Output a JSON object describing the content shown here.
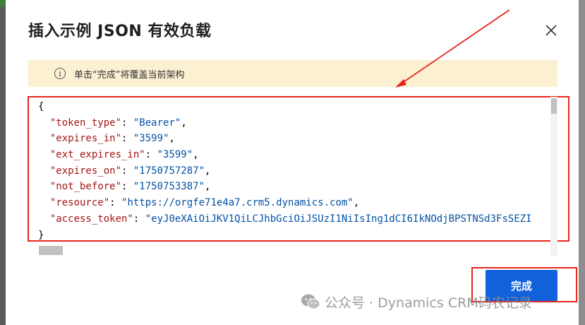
{
  "dialog": {
    "title": "插入示例 JSON 有效负载",
    "info_text": "单击“完成”将覆盖当前架构",
    "done_label": "完成"
  },
  "editor": {
    "lines": [
      [
        {
          "t": "p",
          "v": "{"
        }
      ],
      [
        {
          "t": "p",
          "v": "  "
        },
        {
          "t": "k",
          "v": "\"token_type\""
        },
        {
          "t": "p",
          "v": ": "
        },
        {
          "t": "s",
          "v": "\"Bearer\""
        },
        {
          "t": "p",
          "v": ","
        }
      ],
      [
        {
          "t": "p",
          "v": "  "
        },
        {
          "t": "k",
          "v": "\"expires_in\""
        },
        {
          "t": "p",
          "v": ": "
        },
        {
          "t": "s",
          "v": "\"3599\""
        },
        {
          "t": "p",
          "v": ","
        }
      ],
      [
        {
          "t": "p",
          "v": "  "
        },
        {
          "t": "k",
          "v": "\"ext_expires_in\""
        },
        {
          "t": "p",
          "v": ": "
        },
        {
          "t": "s",
          "v": "\"3599\""
        },
        {
          "t": "p",
          "v": ","
        }
      ],
      [
        {
          "t": "p",
          "v": "  "
        },
        {
          "t": "k",
          "v": "\"expires_on\""
        },
        {
          "t": "p",
          "v": ": "
        },
        {
          "t": "s",
          "v": "\"1750757287\""
        },
        {
          "t": "p",
          "v": ","
        }
      ],
      [
        {
          "t": "p",
          "v": "  "
        },
        {
          "t": "k",
          "v": "\"not_before\""
        },
        {
          "t": "p",
          "v": ": "
        },
        {
          "t": "s",
          "v": "\"1750753387\""
        },
        {
          "t": "p",
          "v": ","
        }
      ],
      [
        {
          "t": "p",
          "v": "  "
        },
        {
          "t": "k",
          "v": "\"resource\""
        },
        {
          "t": "p",
          "v": ": "
        },
        {
          "t": "s",
          "v": "\"https://orgfe71e4a7.crm5.dynamics.com\""
        },
        {
          "t": "p",
          "v": ","
        }
      ],
      [
        {
          "t": "p",
          "v": "  "
        },
        {
          "t": "k",
          "v": "\"access_token\""
        },
        {
          "t": "p",
          "v": ": "
        },
        {
          "t": "s",
          "v": "\"eyJ0eXAiOiJKV1QiLCJhbGciOiJSUzI1NiIsIng1dCI6IkNOdjBPSTNSd3FsSEZI"
        }
      ],
      [
        {
          "t": "p",
          "v": "}"
        }
      ]
    ]
  },
  "watermark": {
    "text": "公众号 · Dynamics CRM码农记录"
  },
  "colors": {
    "accent": "#1161dd",
    "highlight": "#e8261d",
    "info_bg": "#fbf0d2",
    "json_key": "#a31515",
    "json_string": "#0451a5"
  }
}
